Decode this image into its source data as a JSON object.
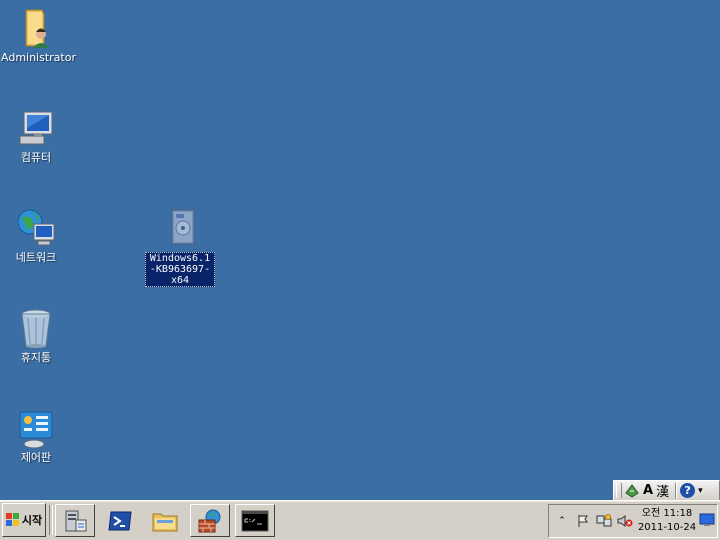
{
  "desktop": {
    "icons": [
      {
        "label": "Administrator",
        "icon": "user-folder-icon"
      },
      {
        "label": "컴퓨터",
        "icon": "computer-icon"
      },
      {
        "label": "네트워크",
        "icon": "network-icon"
      },
      {
        "label": "휴지통",
        "icon": "recycle-bin-icon"
      },
      {
        "label": "제어판",
        "icon": "control-panel-icon"
      },
      {
        "label": "Windows6.1-KB963697-x64",
        "icon": "installer-package-icon"
      }
    ]
  },
  "langbar": {
    "ime_mode": "A",
    "hanja": "漢",
    "help": "?"
  },
  "taskbar": {
    "start_label": "시작",
    "clock": {
      "time": "오전 11:18",
      "date": "2011-10-24"
    }
  },
  "colors": {
    "desktop": "#3a6ea5",
    "taskbar": "#d4d0c8",
    "selection": "#0a246a"
  }
}
